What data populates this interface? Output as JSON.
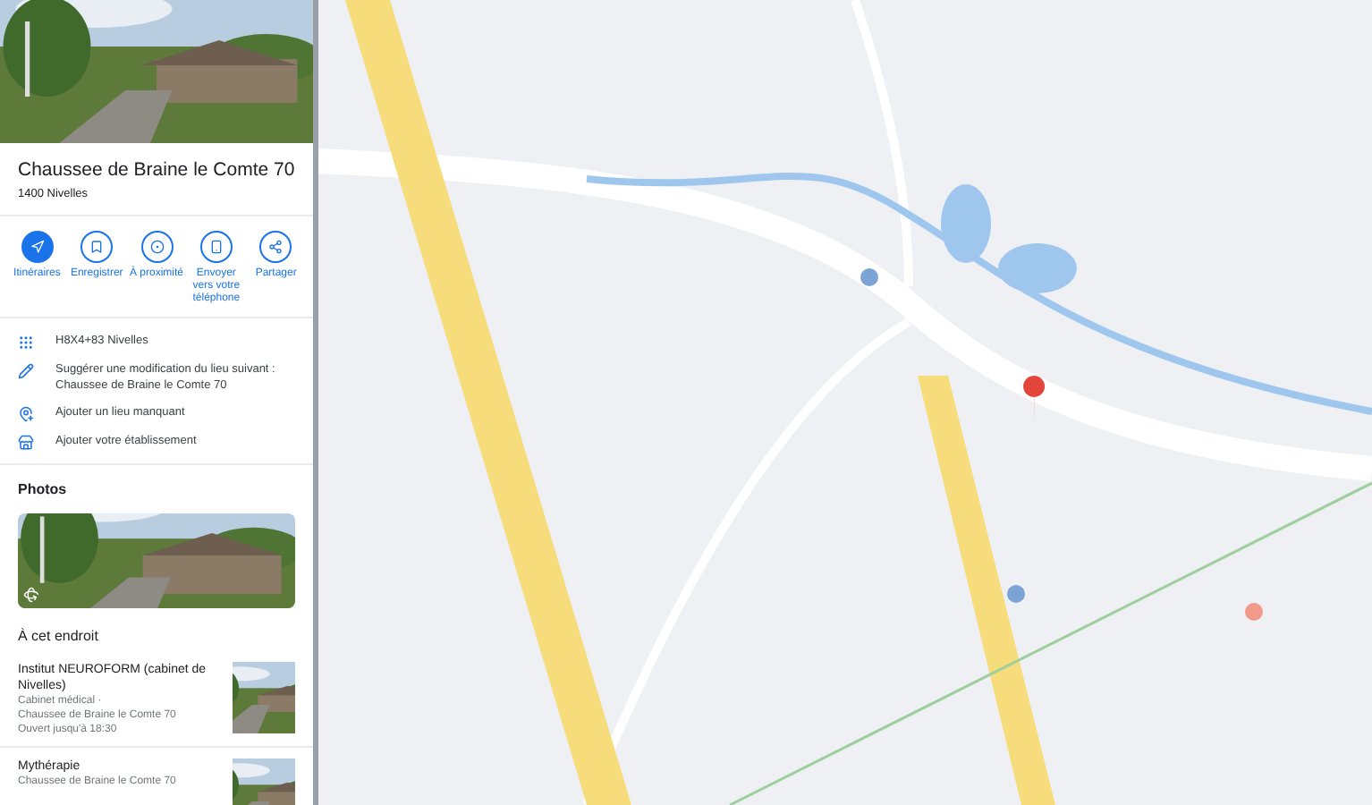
{
  "place": {
    "title": "Chaussee de Braine le Comte 70",
    "subtitle": "1400 Nivelles"
  },
  "actions": [
    {
      "kind": "directions",
      "label": "Itinéraires"
    },
    {
      "kind": "save",
      "label": "Enregistrer"
    },
    {
      "kind": "nearby",
      "label": "À proximité"
    },
    {
      "kind": "phone",
      "label": "Envoyer vers votre téléphone"
    },
    {
      "kind": "share",
      "label": "Partager"
    }
  ],
  "info_rows": [
    {
      "kind": "plus_code",
      "text": "H8X4+83 Nivelles"
    },
    {
      "kind": "edit",
      "text": "Suggérer une modification du lieu suivant : Chaussee de Braine le Comte 70"
    },
    {
      "kind": "add_place",
      "text": "Ajouter un lieu manquant"
    },
    {
      "kind": "business",
      "text": "Ajouter votre établissement"
    }
  ],
  "photos": {
    "heading": "Photos"
  },
  "here": {
    "heading": "À cet endroit",
    "places": [
      {
        "name": "Institut NEUROFORM (cabinet de Nivelles)",
        "lines": [
          "Cabinet médical ·",
          "Chaussee de Braine le Comte 70",
          "Ouvert jusqu'à 18:30"
        ]
      },
      {
        "name": "Mythérapie",
        "lines": [
          "Chaussee de Braine le Comte 70"
        ]
      }
    ]
  }
}
